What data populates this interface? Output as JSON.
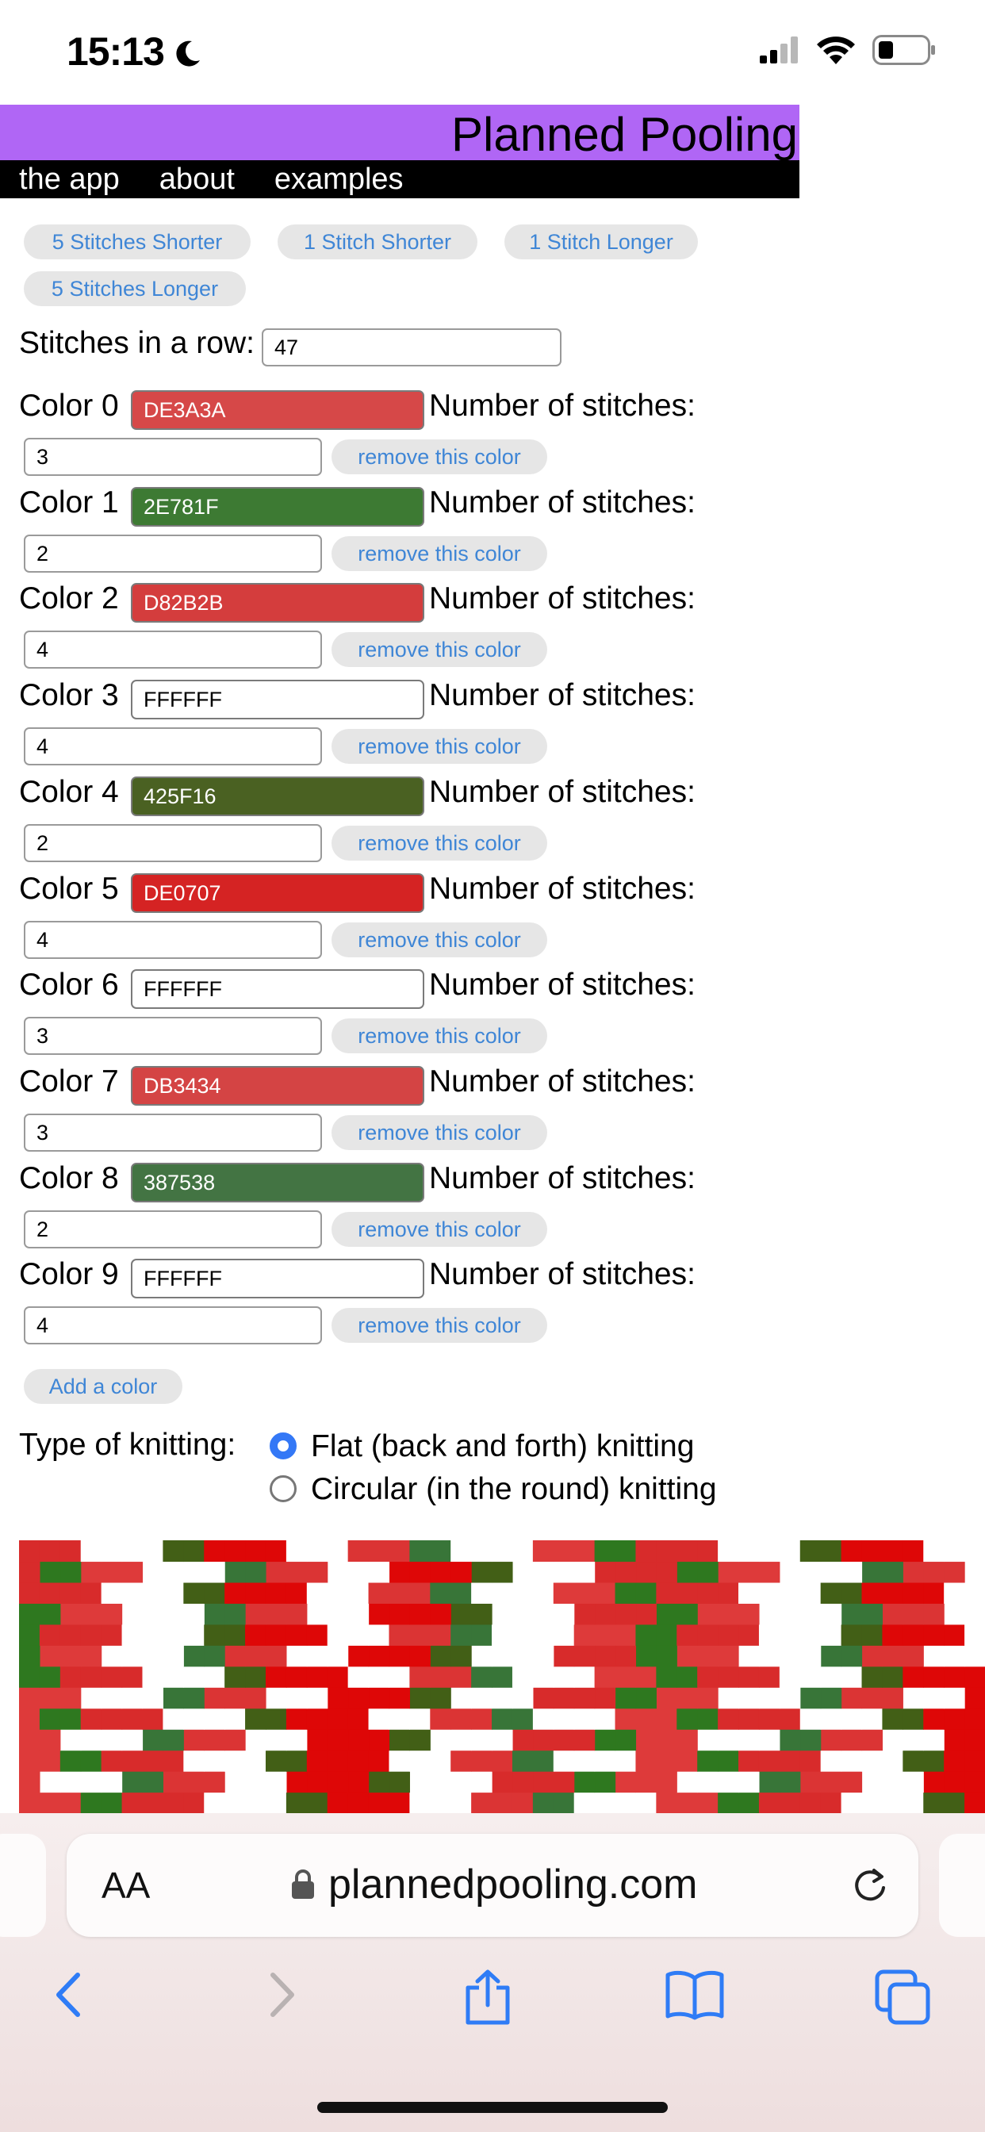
{
  "status_bar": {
    "time": "15:13",
    "icons": [
      "moon-icon",
      "signal-icon",
      "wifi-icon",
      "battery-icon"
    ]
  },
  "header": {
    "title": "Planned Pooling",
    "nav": [
      "the app",
      "about",
      "examples"
    ]
  },
  "length_buttons": [
    "5 Stitches Shorter",
    "1 Stitch Shorter",
    "1 Stitch Longer",
    "5 Stitches Longer"
  ],
  "stitches_row": {
    "label": "Stitches in a row:",
    "value": "47"
  },
  "color_labels": {
    "stitches_label": "Number of stitches:",
    "remove_label": "remove this color"
  },
  "colors": [
    {
      "label": "Color 0",
      "hex": "DE3A3A",
      "stitches": "3",
      "bg": "#d64848",
      "fg": "#ffffff"
    },
    {
      "label": "Color 1",
      "hex": "2E781F",
      "stitches": "2",
      "bg": "#3d7a33",
      "fg": "#ffffff"
    },
    {
      "label": "Color 2",
      "hex": "D82B2B",
      "stitches": "4",
      "bg": "#d43d3d",
      "fg": "#ffffff"
    },
    {
      "label": "Color 3",
      "hex": "FFFFFF",
      "stitches": "4",
      "bg": "#ffffff",
      "fg": "#000000"
    },
    {
      "label": "Color 4",
      "hex": "425F16",
      "stitches": "2",
      "bg": "#4a6122",
      "fg": "#ffffff"
    },
    {
      "label": "Color 5",
      "hex": "DE0707",
      "stitches": "4",
      "bg": "#d52323",
      "fg": "#ffffff"
    },
    {
      "label": "Color 6",
      "hex": "FFFFFF",
      "stitches": "3",
      "bg": "#ffffff",
      "fg": "#000000"
    },
    {
      "label": "Color 7",
      "hex": "DB3434",
      "stitches": "3",
      "bg": "#d44444",
      "fg": "#ffffff"
    },
    {
      "label": "Color 8",
      "hex": "387538",
      "stitches": "2",
      "bg": "#437443",
      "fg": "#ffffff"
    },
    {
      "label": "Color 9",
      "hex": "FFFFFF",
      "stitches": "4",
      "bg": "#ffffff",
      "fg": "#000000"
    }
  ],
  "add_color_label": "Add a color",
  "knitting_type": {
    "label": "Type of knitting:",
    "options": [
      "Flat (back and forth) knitting",
      "Circular (in the round) knitting"
    ],
    "selected": 0
  },
  "browser": {
    "aa_label": "AA",
    "url": "plannedpooling.com"
  },
  "accent_color": "#b066f5"
}
